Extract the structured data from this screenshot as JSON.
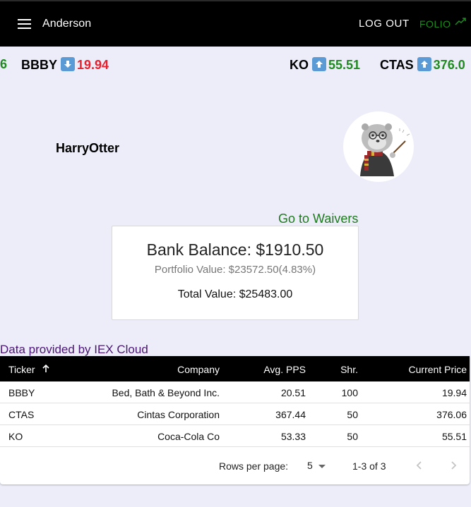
{
  "appbar": {
    "title": "Anderson",
    "logout_label": "LOG OUT",
    "brand": "FOLIO",
    "menu_icon": "menu-icon",
    "brand_icon": "trending-up-icon"
  },
  "ticker": [
    {
      "symbol": "",
      "price": "6",
      "direction": "up"
    },
    {
      "symbol": "BBBY",
      "price": "19.94",
      "direction": "down"
    },
    {
      "symbol": "KO",
      "price": "55.51",
      "direction": "up"
    },
    {
      "symbol": "CTAS",
      "price": "376.0",
      "direction": "up"
    }
  ],
  "profile": {
    "username": "HarryOtter",
    "avatar": "otter-wizard-avatar"
  },
  "waivers_link": "Go to Waivers",
  "balance": {
    "bank_balance": "Bank Balance: $1910.50",
    "portfolio_value": "Portfolio Value: $23572.50(4.83%)",
    "total_value": "Total Value: $25483.00"
  },
  "data_source_link": "Data provided by IEX Cloud",
  "table": {
    "headers": {
      "ticker": "Ticker",
      "company": "Company",
      "avg_pps": "Avg. PPS",
      "shares": "Shr.",
      "current_price": "Current Price"
    },
    "sort": {
      "column": "ticker",
      "direction": "ascending"
    },
    "rows": [
      {
        "ticker": "BBBY",
        "company": "Bed, Bath & Beyond Inc.",
        "avg_pps": "20.51",
        "shares": "100",
        "current_price": "19.94"
      },
      {
        "ticker": "CTAS",
        "company": "Cintas Corporation",
        "avg_pps": "367.44",
        "shares": "50",
        "current_price": "376.06"
      },
      {
        "ticker": "KO",
        "company": "Coca-Cola Co",
        "avg_pps": "53.33",
        "shares": "50",
        "current_price": "55.51"
      }
    ],
    "pagination": {
      "rows_per_page_label": "Rows per page:",
      "rows_per_page": "5",
      "range": "1-3 of 3"
    }
  },
  "colors": {
    "up": "#1f8a1f",
    "down": "#e8202e",
    "link_green": "#1f7a1f",
    "link_purple": "#4b1576",
    "arrow_box": "#5b9bd5",
    "appbar": "#000000",
    "background": "#ecedf8"
  }
}
